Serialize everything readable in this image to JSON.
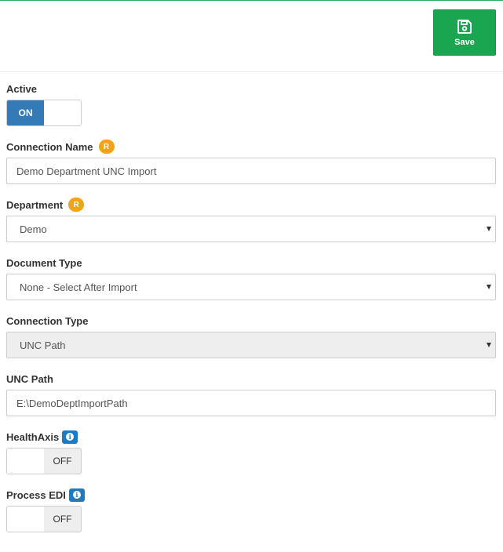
{
  "header": {
    "save_label": "Save"
  },
  "colors": {
    "accent": "#1aa551",
    "toggle_on": "#337ab7",
    "required": "#f2a31a",
    "info": "#1e7bbf"
  },
  "fields": {
    "active": {
      "label": "Active",
      "state": "ON"
    },
    "connection_name": {
      "label": "Connection Name",
      "required_badge": "R",
      "value": "Demo Department UNC Import"
    },
    "department": {
      "label": "Department",
      "required_badge": "R",
      "value": "Demo"
    },
    "document_type": {
      "label": "Document Type",
      "value": "None - Select After Import"
    },
    "connection_type": {
      "label": "Connection Type",
      "value": "UNC Path"
    },
    "unc_path": {
      "label": "UNC Path",
      "value": "E:\\DemoDeptImportPath"
    },
    "healthaxis": {
      "label": "HealthAxis",
      "info_icon": "info-icon",
      "state": "OFF"
    },
    "process_edi": {
      "label": "Process EDI",
      "info_icon": "info-icon",
      "state": "OFF"
    }
  }
}
